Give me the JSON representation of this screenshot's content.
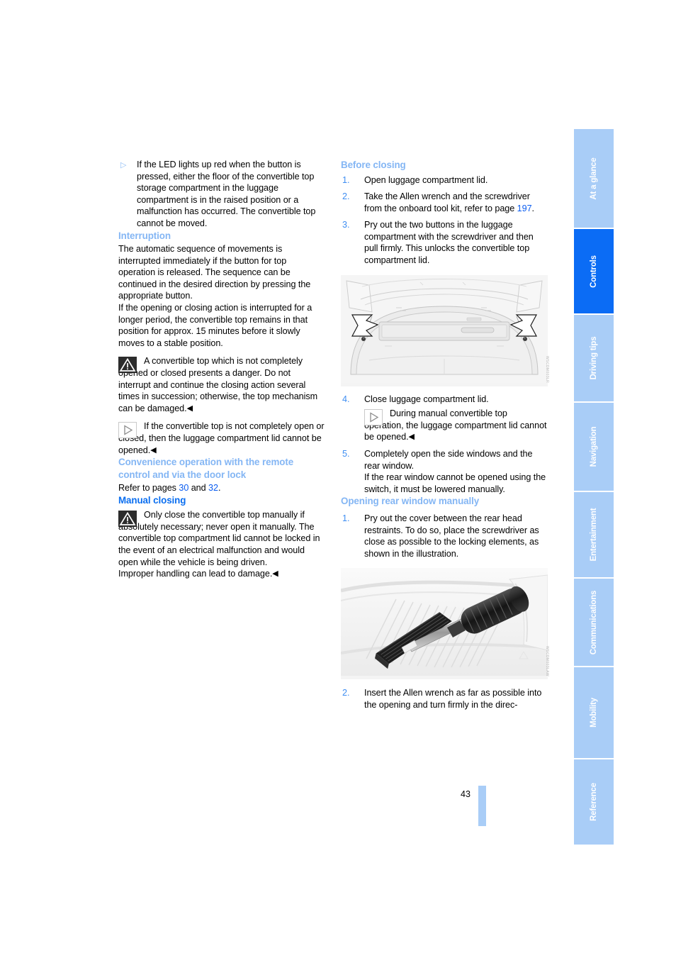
{
  "document": {
    "page_number": "43"
  },
  "left_column": {
    "bullet_note": {
      "glyph": "triangle-right-bullet",
      "text": "If the LED lights up red when the button is pressed, either the floor of the convertible top storage compartment in the luggage compartment is in the raised position or a malfunction has occurred. The convertible top cannot be moved."
    },
    "interruption": {
      "heading": "Interruption",
      "paragraph1": "The automatic sequence of movements is interrupted immediately if the button for top operation is released. The sequence can be continued in the desired direction by pressing the appropriate button.",
      "paragraph2": "If the opening or closing action is interrupted for a longer period, the convertible top remains in that position for approx. 15 minutes before it slowly moves to a stable position.",
      "warning": {
        "icon": "warning-triangle-icon",
        "text": "A convertible top which is not completely opened or closed presents a danger. Do not interrupt and continue the closing action several times in succession; otherwise, the top mechanism can be damaged.",
        "end_mark": "◀"
      },
      "note": {
        "icon": "note-triangle-icon",
        "text": "If the convertible top is not completely open or closed, then the luggage compartment lid cannot be opened.",
        "end_mark": "◀"
      }
    },
    "convenience": {
      "heading": "Convenience operation with the remote control and via the door lock",
      "refer_prefix": "Refer to pages ",
      "refer_page_1": "30",
      "refer_middle": " and ",
      "refer_page_2": "32",
      "refer_suffix": "."
    },
    "manual_closing": {
      "heading": "Manual closing",
      "warning": {
        "icon": "warning-triangle-icon",
        "text": "Only close the convertible top manually if absolutely necessary; never open it manually. The convertible top compartment lid cannot be locked in the event of an electrical malfunction and would open while the vehicle is being driven.",
        "text2": "Improper handling can lead to damage.",
        "end_mark": "◀"
      }
    }
  },
  "right_column": {
    "before_closing": {
      "heading": "Before closing",
      "steps": [
        {
          "num": "1.",
          "text": "Open luggage compartment lid."
        },
        {
          "num": "2.",
          "text": "Take the Allen wrench and the screwdriver from the onboard tool kit, refer to page ",
          "page_ref": "197",
          "text_after": "."
        },
        {
          "num": "3.",
          "text": "Pry out the two buttons in the luggage compartment with the screwdriver and then pull firmly. This unlocks the convertible top compartment lid."
        }
      ]
    },
    "figure_trunk": {
      "alt": "luggage-compartment-illustration",
      "image_id": "WSCDM003LR"
    },
    "steps_after_figure": [
      {
        "num": "4.",
        "text": "Close luggage compartment lid."
      },
      {
        "num": "5.",
        "text": "Completely open the side windows and the rear window.",
        "text2": "If the rear window cannot be opened using the switch, it must be lowered manually."
      }
    ],
    "step4_note": {
      "icon": "note-triangle-icon",
      "text": "During manual convertible top operation, the luggage compartment lid cannot be opened.",
      "end_mark": "◀"
    },
    "opening_rear_window": {
      "heading": "Opening rear window manually",
      "step1": {
        "num": "1.",
        "text": "Pry out the cover between the rear head restraints. To do so, place the screwdriver as close as possible to the locking elements, as shown in the illustration."
      },
      "step2": {
        "num": "2.",
        "text": "Insert the Allen wrench as far as possible into the opening and turn firmly in the direc-"
      }
    },
    "figure_screwdriver": {
      "alt": "screwdriver-prying-cover-illustration",
      "image_id": "WSCDM003LAW"
    }
  },
  "tab_rail": {
    "tabs": [
      {
        "label": "At a glance",
        "active": false
      },
      {
        "label": "Controls",
        "active": true
      },
      {
        "label": "Driving tips",
        "active": false
      },
      {
        "label": "Navigation",
        "active": false
      },
      {
        "label": "Entertainment",
        "active": false
      },
      {
        "label": "Communications",
        "active": false
      },
      {
        "label": "Mobility",
        "active": false
      },
      {
        "label": "Reference",
        "active": false
      }
    ]
  },
  "colors": {
    "heading_tint": "#84b6f4",
    "heading_strong": "#0a6ef0",
    "link": "#0a5cf0",
    "tab_inactive": "#a9cdf7",
    "tab_active": "#0b6cf5"
  }
}
